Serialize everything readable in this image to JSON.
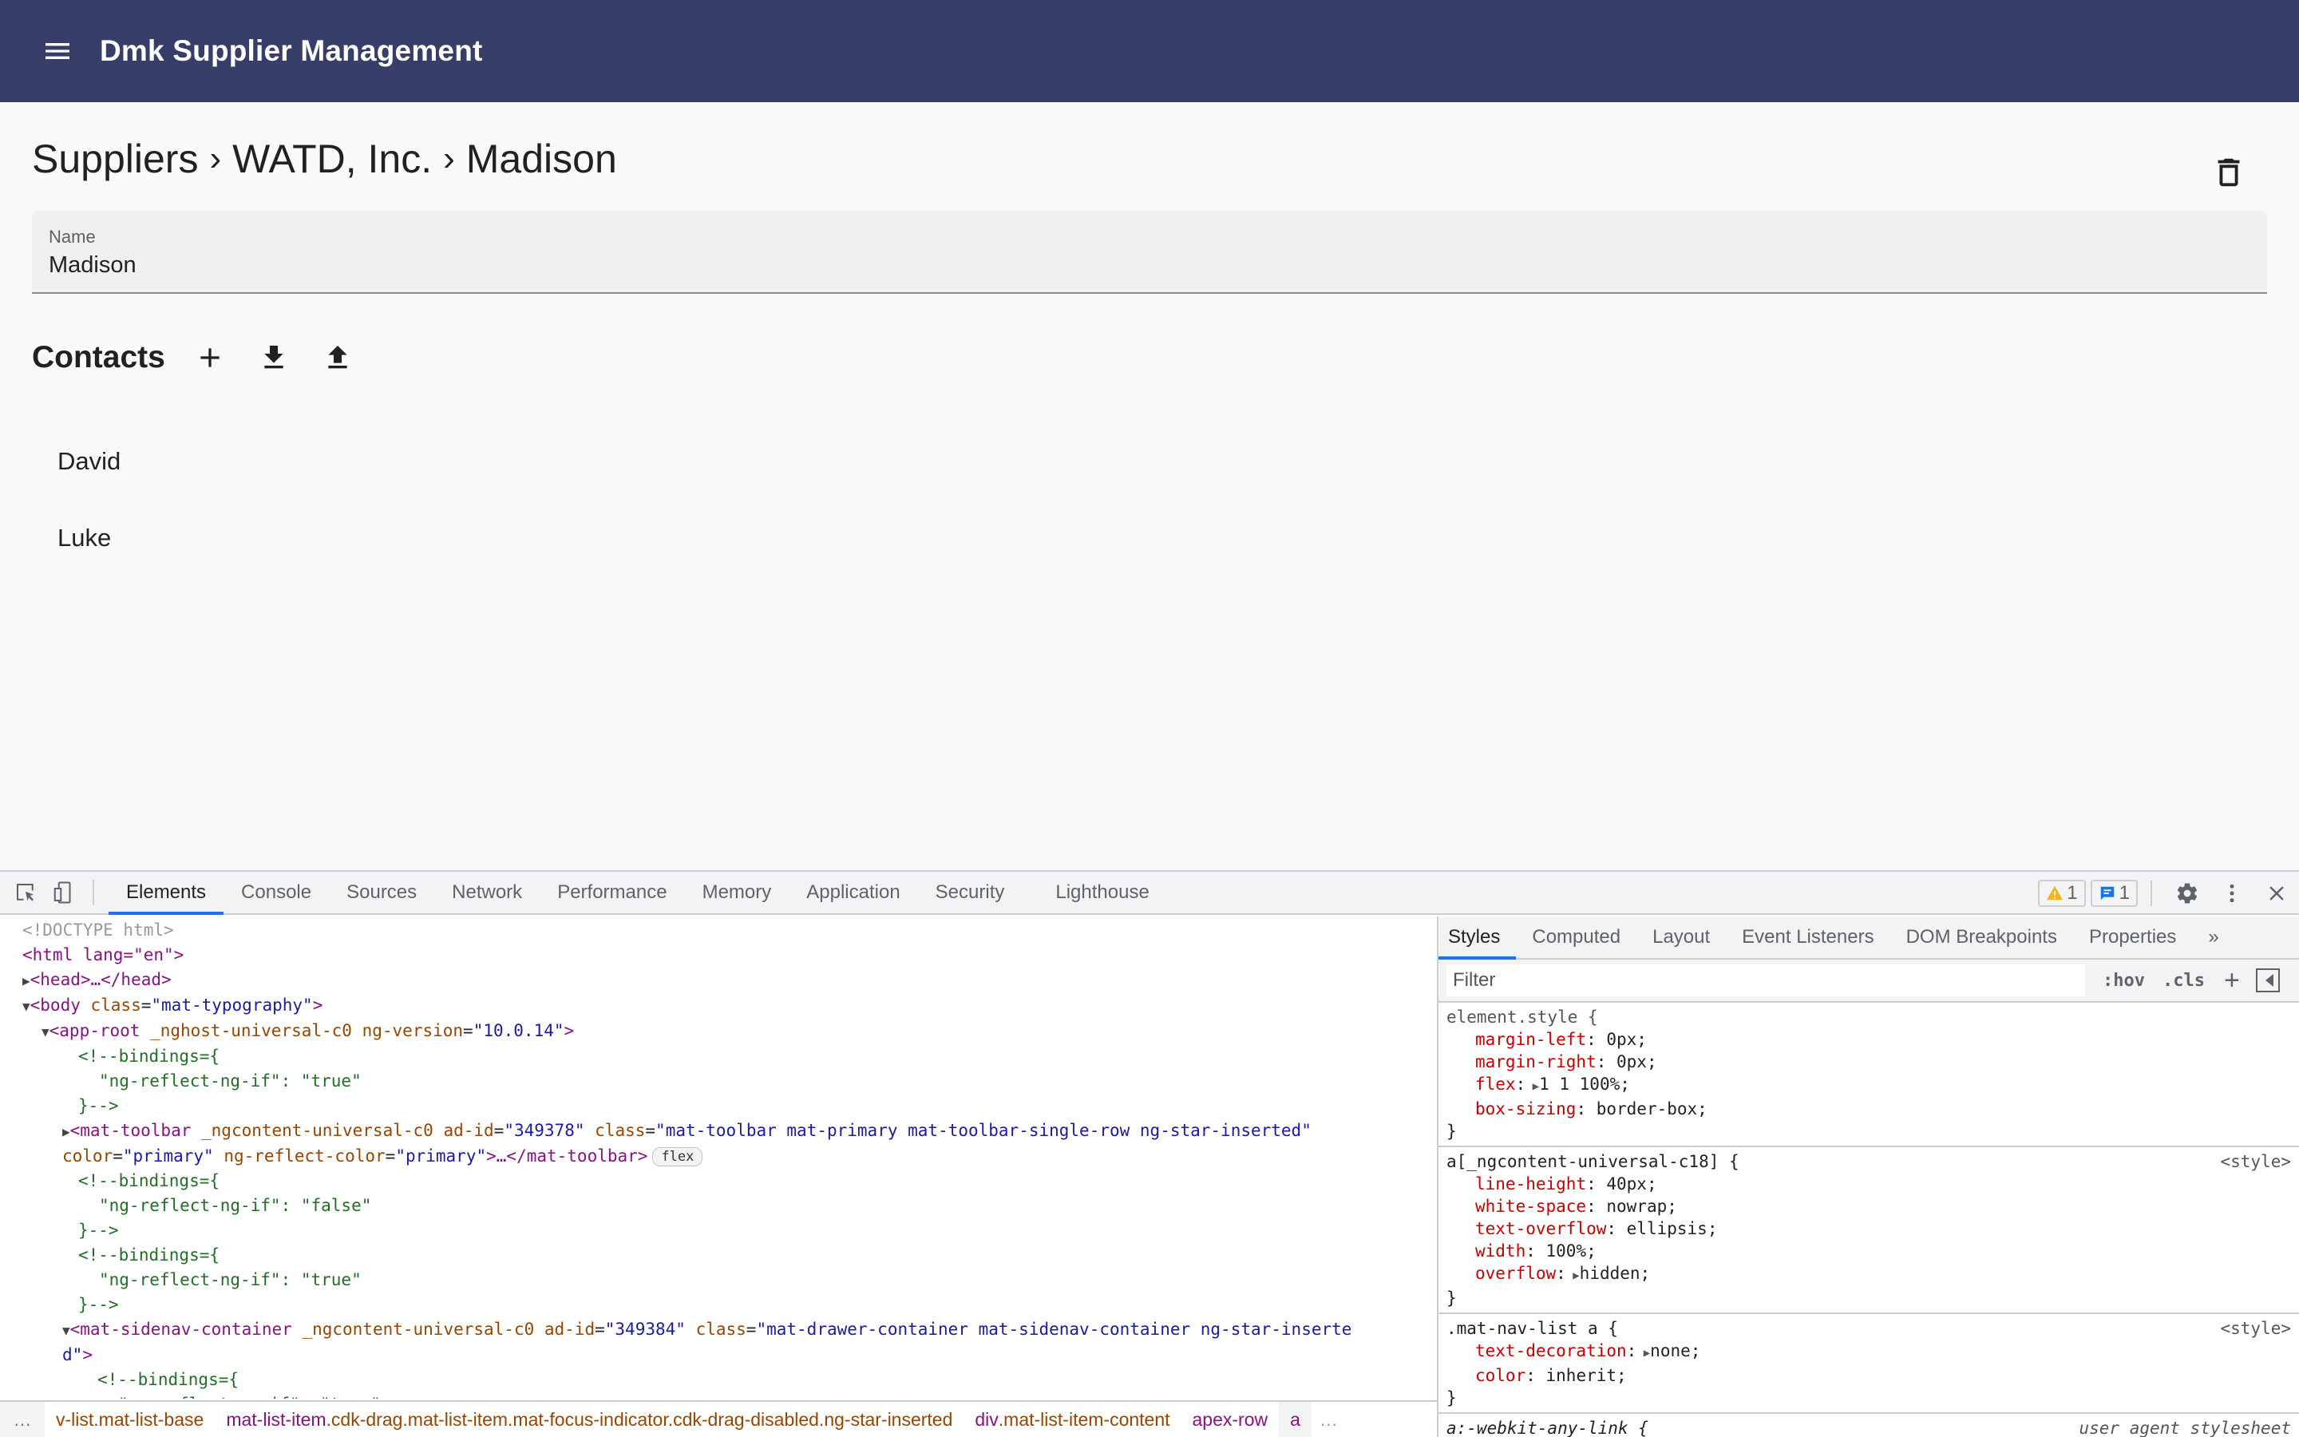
{
  "app": {
    "title": "Dmk Supplier Management",
    "toolbar_color": "#363e69",
    "menu_icon": "menu-icon"
  },
  "breadcrumb": {
    "items": [
      "Suppliers",
      "WATD, Inc.",
      "Madison"
    ],
    "separator": "›"
  },
  "actions": {
    "delete_icon": "delete-icon"
  },
  "name_field": {
    "label": "Name",
    "value": "Madison"
  },
  "contacts": {
    "title": "Contacts",
    "actions": [
      "add-icon",
      "download-icon",
      "upload-icon"
    ],
    "items": [
      "David",
      "Luke"
    ]
  },
  "devtools": {
    "tabs": [
      "Elements",
      "Console",
      "Sources",
      "Network",
      "Performance",
      "Memory",
      "Application",
      "Security",
      "Lighthouse"
    ],
    "active_tab": "Elements",
    "warnings_count": "1",
    "messages_count": "1",
    "dom_tree": {
      "doctype": "<!DOCTYPE html>",
      "html_open": "<html lang=\"en\">",
      "head": "<head>…</head>",
      "body_class": "mat-typography",
      "app_root_attrs": "_nghost-universal-c0",
      "ng_version": "10.0.14",
      "binding_true": "\"ng-reflect-ng-if\": \"true\"",
      "binding_false": "\"ng-reflect-ng-if\": \"false\"",
      "comment_open": "<!--bindings={",
      "comment_close": "}-->",
      "toolbar_adid": "349378",
      "toolbar_class": "mat-toolbar mat-primary mat-toolbar-single-row ng-star-inserted",
      "toolbar_color": "primary",
      "flex_badge": "flex",
      "sidenav_adid": "349384",
      "sidenav_class": "mat-drawer-container mat-sidenav-container ng-star-inserte",
      "sidenav_class_wrap": "d"
    },
    "crumbs": [
      {
        "tag": "",
        "cls": "v-list.mat-list-base"
      },
      {
        "tag": "mat-list-item",
        "cls": ".cdk-drag.mat-list-item.mat-focus-indicator.cdk-drag-disabled.ng-star-inserted"
      },
      {
        "tag": "div",
        "cls": ".mat-list-item-content"
      },
      {
        "tag": "apex-row",
        "cls": ""
      },
      {
        "tag": "a",
        "cls": ""
      }
    ],
    "styles_tabs": [
      "Styles",
      "Computed",
      "Layout",
      "Event Listeners",
      "DOM Breakpoints",
      "Properties"
    ],
    "filter_placeholder": "Filter",
    "hov": ":hov",
    "cls": ".cls",
    "rules": [
      {
        "selector": "element.style {",
        "source": "",
        "decls": [
          {
            "prop": "margin-left",
            "val": "0px;"
          },
          {
            "prop": "margin-right",
            "val": "0px;"
          },
          {
            "prop": "flex",
            "val": "1 1 100%;",
            "expandable": true
          },
          {
            "prop": "box-sizing",
            "val": "border-box;"
          }
        ]
      },
      {
        "selector": "a[_ngcontent-universal-c18] {",
        "source": "<style>",
        "decls": [
          {
            "prop": "line-height",
            "val": "40px;"
          },
          {
            "prop": "white-space",
            "val": "nowrap;"
          },
          {
            "prop": "text-overflow",
            "val": "ellipsis;"
          },
          {
            "prop": "width",
            "val": "100%;"
          },
          {
            "prop": "overflow",
            "val": "hidden;",
            "expandable": true
          }
        ]
      },
      {
        "selector": ".mat-nav-list a {",
        "source": "<style>",
        "decls": [
          {
            "prop": "text-decoration",
            "val": "none;",
            "expandable": true
          },
          {
            "prop": "color",
            "val": "inherit;"
          }
        ]
      },
      {
        "selector": "a:-webkit-any-link {",
        "source": "user agent stylesheet",
        "decls": []
      }
    ]
  }
}
